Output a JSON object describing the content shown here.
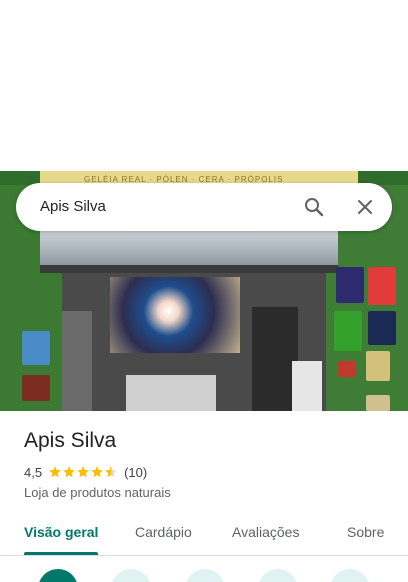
{
  "search": {
    "query": "Apis Silva"
  },
  "hero": {
    "banner_text": "GELÉIA REAL · PÓLEN · CERA · PRÓPOLIS"
  },
  "place": {
    "title": "Apis Silva",
    "rating": "4,5",
    "stars": 4.5,
    "review_count": "(10)",
    "category": "Loja de produtos naturais"
  },
  "tabs": [
    {
      "label": "Visão geral",
      "active": true
    },
    {
      "label": "Cardápio",
      "active": false
    },
    {
      "label": "Avaliações",
      "active": false
    },
    {
      "label": "Sobre",
      "active": false
    }
  ],
  "actions": [
    {
      "name": "directions-icon"
    },
    {
      "name": "save-icon"
    },
    {
      "name": "nearby-icon"
    },
    {
      "name": "phone-icon"
    },
    {
      "name": "share-icon"
    }
  ],
  "colors": {
    "accent": "#00796b",
    "star": "#fbbc04",
    "text": "#202124",
    "muted": "#5f6368"
  }
}
